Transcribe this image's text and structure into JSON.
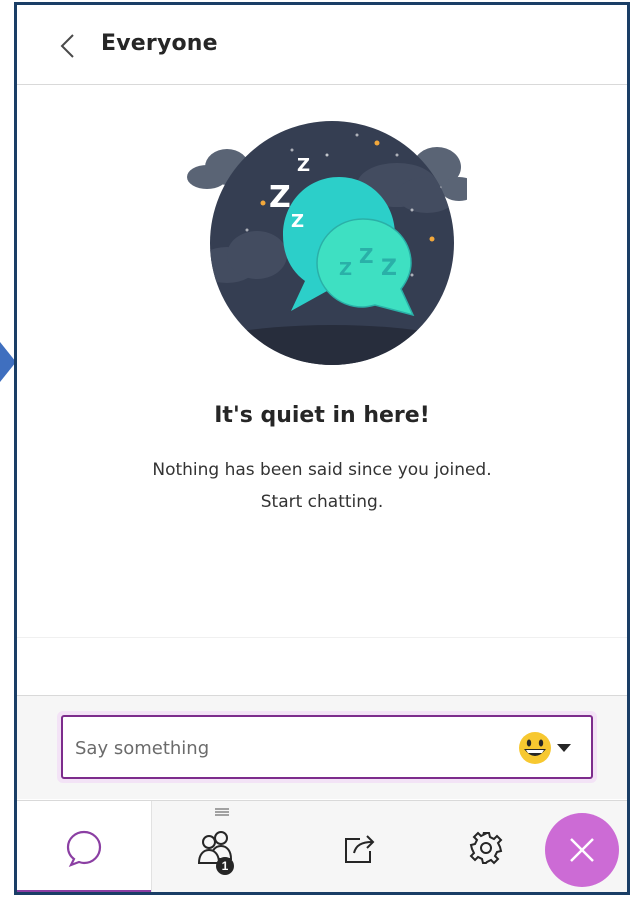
{
  "header": {
    "title": "Everyone"
  },
  "empty_state": {
    "title": "It's quiet in here!",
    "line1": "Nothing has been said since you joined.",
    "line2": "Start chatting."
  },
  "compose": {
    "placeholder": "Say something",
    "value": ""
  },
  "tabs": {
    "active": "chat",
    "people_badge": "1"
  },
  "colors": {
    "accent": "#8b3fa3",
    "close_button": "#cc6bd5",
    "panel_border": "#1a3e66",
    "night_sky": "#353e52",
    "bubble_teal": "#2ccfc9"
  },
  "icons": [
    "back-chevron-icon",
    "sleeping-chat-illustration",
    "emoji-icon",
    "chat-bubble-icon",
    "people-icon",
    "share-icon",
    "gear-icon",
    "close-icon"
  ]
}
